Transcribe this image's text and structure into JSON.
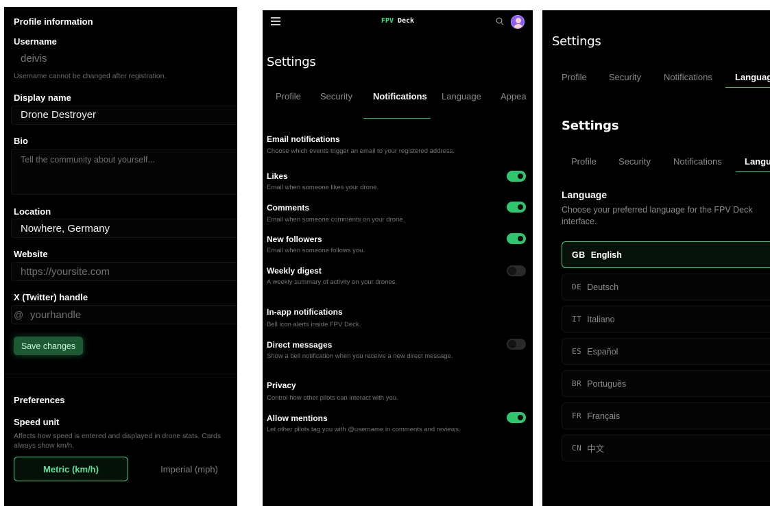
{
  "panel1": {
    "profile_heading": "Profile information",
    "username_label": "Username",
    "username_value": "deivis",
    "username_help": "Username cannot be changed after registration.",
    "display_name_label": "Display name",
    "display_name_value": "Drone Destroyer",
    "bio_label": "Bio",
    "bio_placeholder": "Tell the community about yourself...",
    "location_label": "Location",
    "location_value": "Nowhere, Germany",
    "website_label": "Website",
    "website_placeholder": "https://yoursite.com",
    "twitter_label": "X (Twitter) handle",
    "twitter_prefix": "@",
    "twitter_placeholder": "yourhandle",
    "save_label": "Save changes",
    "preferences_heading": "Preferences",
    "speed_unit_label": "Speed unit",
    "speed_unit_help_line1": "Affects how speed is entered and displayed in drone stats. Cards",
    "speed_unit_help_line2": "always show km/h.",
    "speed_options": [
      "Metric (km/h)",
      "Imperial (mph)"
    ],
    "speed_selected": "Metric (km/h)"
  },
  "panel2": {
    "brand_prefix": "FPV",
    "brand_suffix": " Deck",
    "page_title": "Settings",
    "tabs": [
      "Profile",
      "Security",
      "Notifications",
      "Language",
      "Appea"
    ],
    "active_tab": "Notifications",
    "email_section": {
      "title": "Email notifications",
      "subtitle": "Choose which events trigger an email to your registered address."
    },
    "email_rows": [
      {
        "title": "Likes",
        "subtitle": "Email when someone likes your drone.",
        "enabled": true
      },
      {
        "title": "Comments",
        "subtitle": "Email when someone comments on your drone.",
        "enabled": true
      },
      {
        "title": "New followers",
        "subtitle": "Email when someone follows you.",
        "enabled": true
      },
      {
        "title": "Weekly digest",
        "subtitle": "A weekly summary of activity on your drones.",
        "enabled": false
      }
    ],
    "inapp_section": {
      "title": "In-app notifications",
      "subtitle": "Bell icon alerts inside FPV Deck."
    },
    "inapp_rows": [
      {
        "title": "Direct messages",
        "subtitle": "Show a bell notification when you receive a new direct message.",
        "enabled": false
      }
    ],
    "privacy_section": {
      "title": "Privacy",
      "subtitle": "Control how other pilots can interact with you."
    },
    "privacy_rows": [
      {
        "title": "Allow mentions",
        "subtitle": "Let other pilots tag you with @username in comments and reviews.",
        "enabled": true
      }
    ],
    "accent_color": "#2ec76f"
  },
  "panel3": {
    "outer_title": "Settings",
    "outer_tabs": [
      "Profile",
      "Security",
      "Notifications",
      "Languag"
    ],
    "inner_title": "Settings",
    "inner_tabs": [
      "Profile",
      "Security",
      "Notifications",
      "Langu"
    ],
    "language_heading": "Language",
    "language_desc": "Choose your preferred language for the FPV Deck interface.",
    "languages": [
      {
        "code": "GB",
        "name": "English",
        "selected": true
      },
      {
        "code": "DE",
        "name": "Deutsch",
        "selected": false
      },
      {
        "code": "IT",
        "name": "Italiano",
        "selected": false
      },
      {
        "code": "ES",
        "name": "Español",
        "selected": false
      },
      {
        "code": "BR",
        "name": "Português",
        "selected": false
      },
      {
        "code": "FR",
        "name": "Français",
        "selected": false
      },
      {
        "code": "CN",
        "name": "中文",
        "selected": false
      }
    ]
  }
}
